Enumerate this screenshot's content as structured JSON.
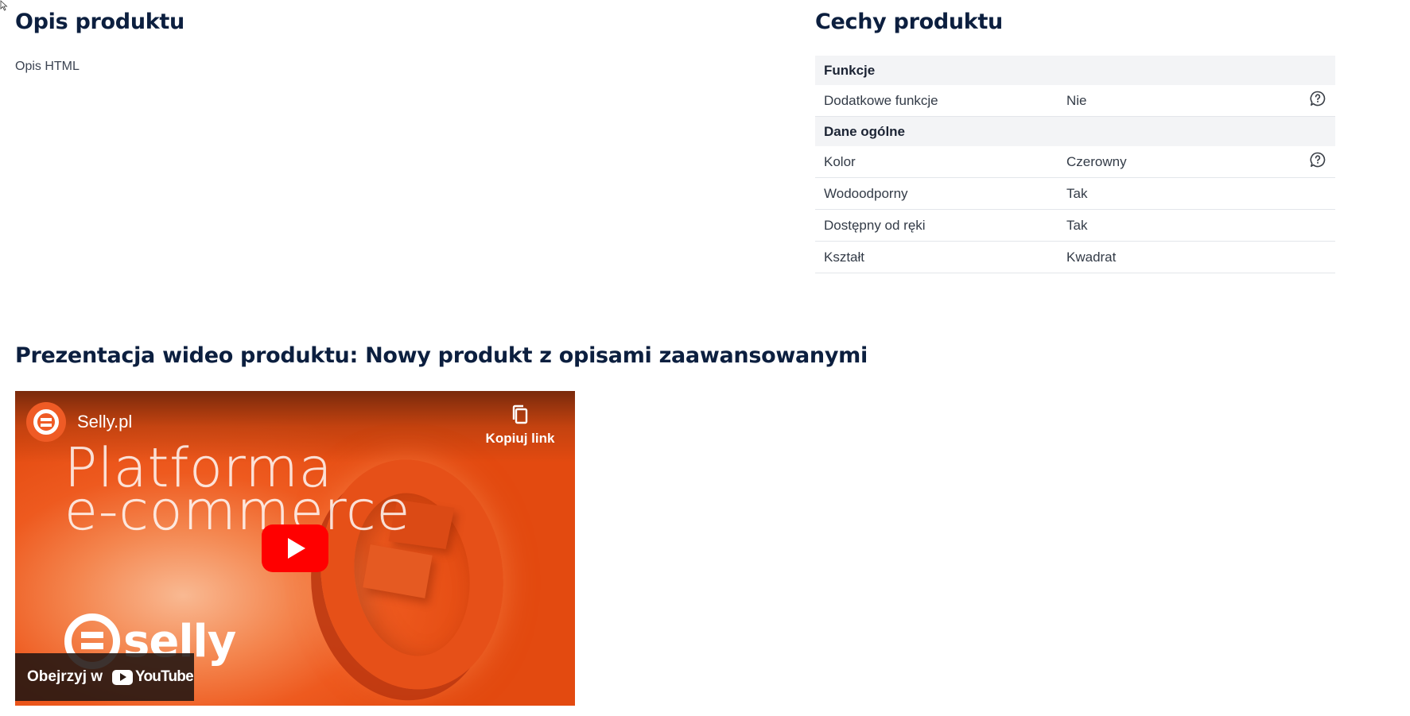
{
  "description": {
    "title": "Opis produktu",
    "body": "Opis HTML"
  },
  "features": {
    "title": "Cechy produktu",
    "groups": [
      {
        "label": "Funkcje",
        "rows": [
          {
            "name": "Dodatkowe funkcje",
            "value": "Nie",
            "help_icon": "question-bubble-icon"
          }
        ]
      },
      {
        "label": "Dane ogólne",
        "rows": [
          {
            "name": "Kolor",
            "value": "Czerowny",
            "help_icon": "question-bubble-icon"
          },
          {
            "name": "Wodoodporny",
            "value": "Tak"
          },
          {
            "name": "Dostępny od ręki",
            "value": "Tak"
          },
          {
            "name": "Kształt",
            "value": "Kwadrat"
          }
        ]
      }
    ]
  },
  "video": {
    "title": "Prezentacja wideo produktu: Nowy produkt z opisami zaawansowanymi",
    "channel_name": "Selly.pl",
    "copy_link_label": "Kopiuj link",
    "thumbnail_line1": "Platforma",
    "thumbnail_line2": "e-commerce",
    "logo_word": "selly",
    "watch_on_label": "Obejrzyj w",
    "youtube_word": "YouTube",
    "play_icon": "play-icon",
    "accent_color": "#ff0000",
    "brand_color": "#ef5b25"
  },
  "colors": {
    "heading": "#0c1f3f",
    "group_row_bg": "#f3f4f6"
  }
}
